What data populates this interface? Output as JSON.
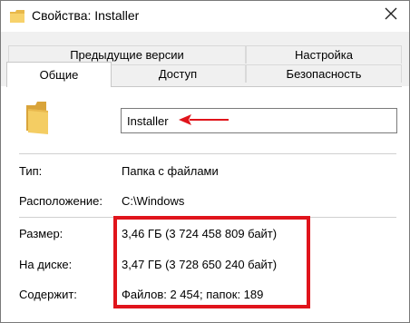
{
  "window": {
    "title": "Свойства: Installer",
    "accent": "#e0141b"
  },
  "tabs": {
    "row1": [
      {
        "label": "Предыдущие версии"
      },
      {
        "label": "Настройка"
      }
    ],
    "row2": [
      {
        "label": "Общие",
        "selected": true
      },
      {
        "label": "Доступ"
      },
      {
        "label": "Безопасность"
      }
    ]
  },
  "general": {
    "name_value": "Installer",
    "props": [
      {
        "label": "Тип:",
        "value": "Папка с файлами"
      },
      {
        "label": "Расположение:",
        "value": "C:\\Windows"
      },
      {
        "label": "Размер:",
        "value": "3,46 ГБ (3 724 458 809 байт)"
      },
      {
        "label": "На диске:",
        "value": "3,47 ГБ (3 728 650 240 байт)"
      },
      {
        "label": "Содержит:",
        "value": "Файлов: 2 454; папок: 189"
      }
    ]
  },
  "icons": {
    "title_icon": "folder-icon",
    "close": "close-icon",
    "big_folder": "folder-icon",
    "annotation_arrow": "red-arrow-icon"
  }
}
